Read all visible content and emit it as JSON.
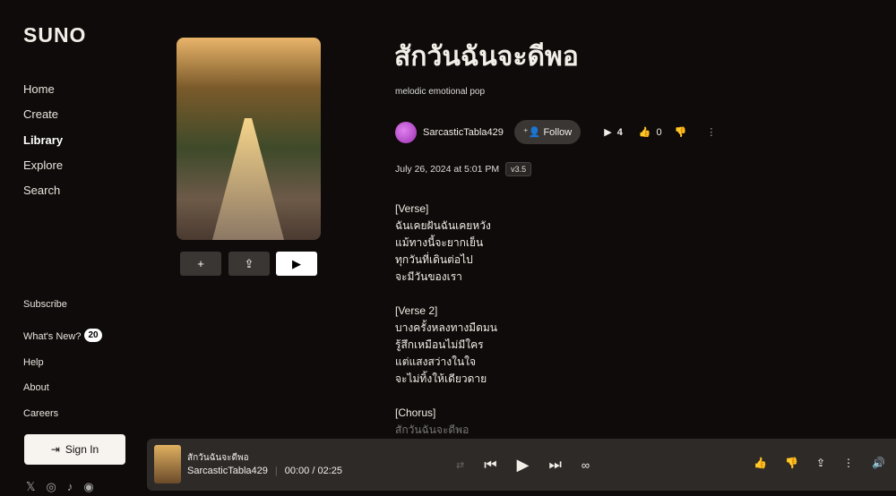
{
  "brand": "SUNO",
  "nav": [
    {
      "label": "Home"
    },
    {
      "label": "Create"
    },
    {
      "label": "Library",
      "active": true
    },
    {
      "label": "Explore"
    },
    {
      "label": "Search"
    }
  ],
  "bottom_links": {
    "subscribe": "Subscribe",
    "whats_new": "What's New?",
    "whats_new_count": "20",
    "help": "Help",
    "about": "About",
    "careers": "Careers"
  },
  "sign_in": "Sign In",
  "social": [
    "x-icon",
    "instagram-icon",
    "tiktok-icon",
    "discord-icon"
  ],
  "song": {
    "title": "สักวันฉันจะดีพอ",
    "tags": "melodic emotional pop",
    "artist": "SarcasticTabla429",
    "follow": "Follow",
    "plays": "4",
    "likes": "0",
    "date": "July 26, 2024 at 5:01 PM",
    "version": "v3.5"
  },
  "lyrics": [
    "[Verse]",
    "ฉันเคยฝันฉันเคยหวัง",
    "แม้ทางนี้จะยากเย็น",
    "ทุกวันที่เดินต่อไป",
    "จะมีวันของเรา",
    "",
    "[Verse 2]",
    "บางครั้งหลงทางมืดมน",
    "รู้สึกเหมือนไม่มีใคร",
    "แต่แสงสว่างในใจ",
    "จะไม่ทิ้งให้เดียวดาย",
    "",
    "[Chorus]"
  ],
  "lyrics_faded": "สักวันฉันจะดีพอ",
  "player": {
    "title": "สักวันฉันจะดีพอ",
    "artist": "SarcasticTabla429",
    "time": "00:00 / 02:25"
  }
}
